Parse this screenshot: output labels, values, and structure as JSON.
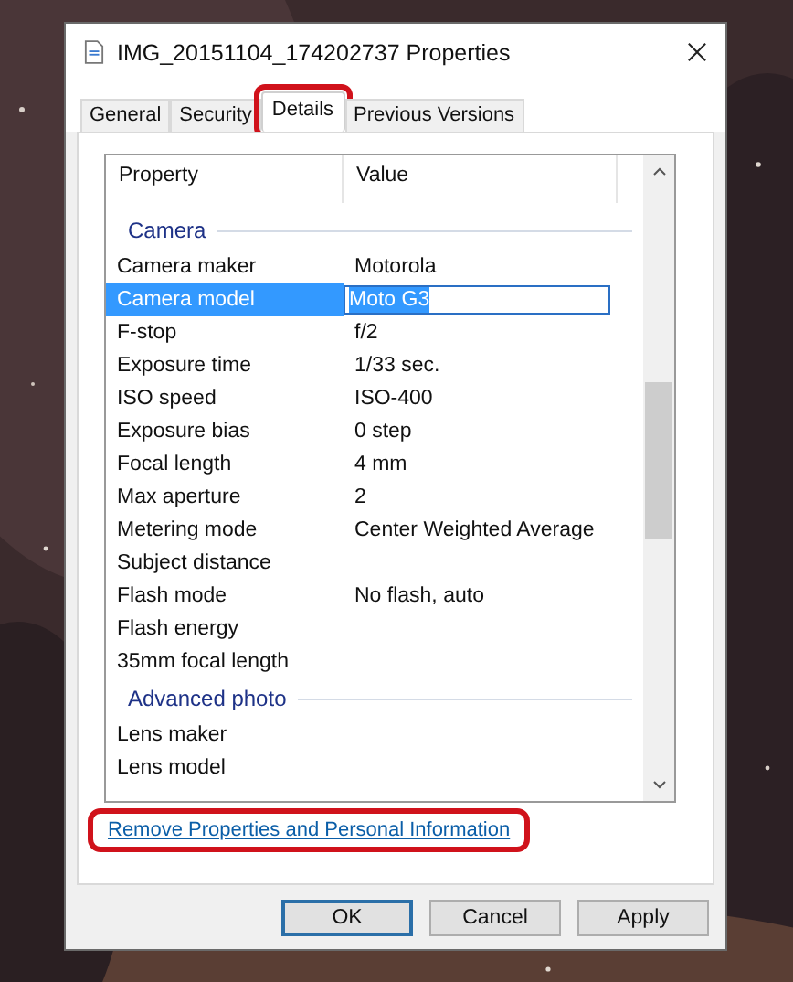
{
  "window": {
    "title": "IMG_20151104_174202737 Properties"
  },
  "tabs": [
    {
      "label": "General",
      "selected": false
    },
    {
      "label": "Security",
      "selected": false
    },
    {
      "label": "Details",
      "selected": true
    },
    {
      "label": "Previous Versions",
      "selected": false
    }
  ],
  "columns": [
    "Property",
    "Value"
  ],
  "groups": [
    {
      "name": "Camera",
      "rows": [
        {
          "property": "Camera maker",
          "value": "Motorola",
          "selected": false
        },
        {
          "property": "Camera model",
          "value": "Moto G3",
          "selected": true
        },
        {
          "property": "F-stop",
          "value": "f/2",
          "selected": false
        },
        {
          "property": "Exposure time",
          "value": "1/33 sec.",
          "selected": false
        },
        {
          "property": "ISO speed",
          "value": "ISO-400",
          "selected": false
        },
        {
          "property": "Exposure bias",
          "value": "0 step",
          "selected": false
        },
        {
          "property": "Focal length",
          "value": "4 mm",
          "selected": false
        },
        {
          "property": "Max aperture",
          "value": "2",
          "selected": false
        },
        {
          "property": "Metering mode",
          "value": "Center Weighted Average",
          "selected": false
        },
        {
          "property": "Subject distance",
          "selected": false
        },
        {
          "property": "Flash mode",
          "value": "No flash, auto",
          "selected": false
        },
        {
          "property": "Flash energy",
          "selected": false
        },
        {
          "property": "35mm focal length",
          "selected": false
        }
      ]
    },
    {
      "name": "Advanced photo",
      "rows": [
        {
          "property": "Lens maker",
          "selected": false
        },
        {
          "property": "Lens model",
          "selected": false
        }
      ]
    }
  ],
  "link": "Remove Properties and Personal Information",
  "buttons": [
    {
      "label": "OK",
      "default": true
    },
    {
      "label": "Cancel",
      "default": false
    },
    {
      "label": "Apply",
      "default": false
    }
  ]
}
